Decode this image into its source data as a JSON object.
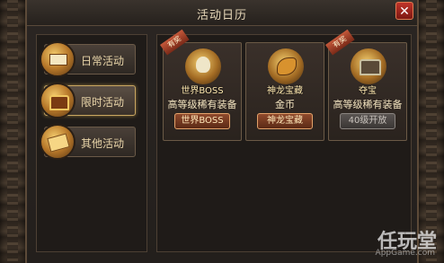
{
  "window": {
    "title": "活动日历"
  },
  "menu": {
    "items": [
      {
        "label": "日常活动",
        "icon": "book-icon",
        "active": false
      },
      {
        "label": "限时活动",
        "icon": "chest-icon",
        "active": true
      },
      {
        "label": "其他活动",
        "icon": "scroll-icon",
        "active": false
      }
    ]
  },
  "cards": [
    {
      "ribbon": "有奖",
      "name": "世界BOSS",
      "reward": "高等级稀有装备",
      "button": "世界BOSS",
      "icon": "skull-icon",
      "disabled": false
    },
    {
      "ribbon": "",
      "name": "神龙宝藏",
      "reward": "金币",
      "button": "神龙宝藏",
      "icon": "dragon-icon",
      "disabled": false
    },
    {
      "ribbon": "有奖",
      "name": "夺宝",
      "reward": "高等级稀有装备",
      "button": "40级开放",
      "icon": "chest-icon",
      "disabled": true
    }
  ],
  "watermark": {
    "main": "任玩堂",
    "sub": "AppGame.com"
  },
  "colors": {
    "accent": "#c9a661",
    "button": "#8f4a2c",
    "close": "#c0342a"
  }
}
